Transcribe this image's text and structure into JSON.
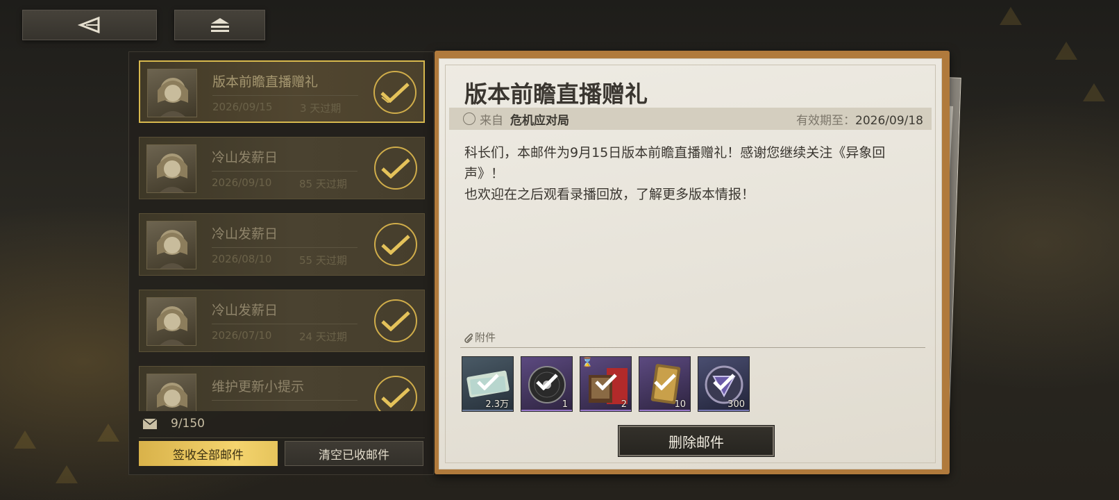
{
  "nav": {
    "back_icon": "back-triangle-icon",
    "home_icon": "home-stack-icon"
  },
  "mail_list": [
    {
      "title": "版本前瞻直播赠礼",
      "date": "2026/09/15",
      "expire": "3 天过期",
      "selected": true
    },
    {
      "title": "冷山发薪日",
      "date": "2026/09/10",
      "expire": "85 天过期",
      "selected": false
    },
    {
      "title": "冷山发薪日",
      "date": "2026/08/10",
      "expire": "55 天过期",
      "selected": false
    },
    {
      "title": "冷山发薪日",
      "date": "2026/07/10",
      "expire": "24 天过期",
      "selected": false
    },
    {
      "title": "维护更新小提示",
      "date": "",
      "expire": "",
      "selected": false
    }
  ],
  "mailbox": {
    "count": "9/150",
    "claim_all_label": "签收全部邮件",
    "clear_label": "清空已收邮件"
  },
  "detail": {
    "title": "版本前瞻直播赠礼",
    "sender_label": "来自",
    "sender_name": "危机应对局",
    "expiry_label": "有效期至：",
    "expiry_date": "2026/09/18",
    "body_lines": [
      "科长们，本邮件为9月15日版本前瞻直播赠礼！感谢您继续关注《异象回声》！",
      "也欢迎在之后观看录播回放，了解更多版本情报！"
    ],
    "attachment_label": "附件",
    "rewards": [
      {
        "name": "ticket",
        "count": "2.3万",
        "bg": "#2f3a44"
      },
      {
        "name": "record-disc",
        "count": "1",
        "bg": "#4a3a66"
      },
      {
        "name": "book-bundle",
        "count": "2",
        "bg": "#4a3a66",
        "timed": true
      },
      {
        "name": "card-pack",
        "count": "10",
        "bg": "#4a3a66"
      },
      {
        "name": "emblem",
        "count": "300",
        "bg": "#3a3e5a"
      }
    ],
    "delete_label": "删除邮件"
  },
  "colors": {
    "accent_gold": "#d8b94e",
    "paper": "#e6e2d8",
    "frame": "#b07a3c"
  }
}
